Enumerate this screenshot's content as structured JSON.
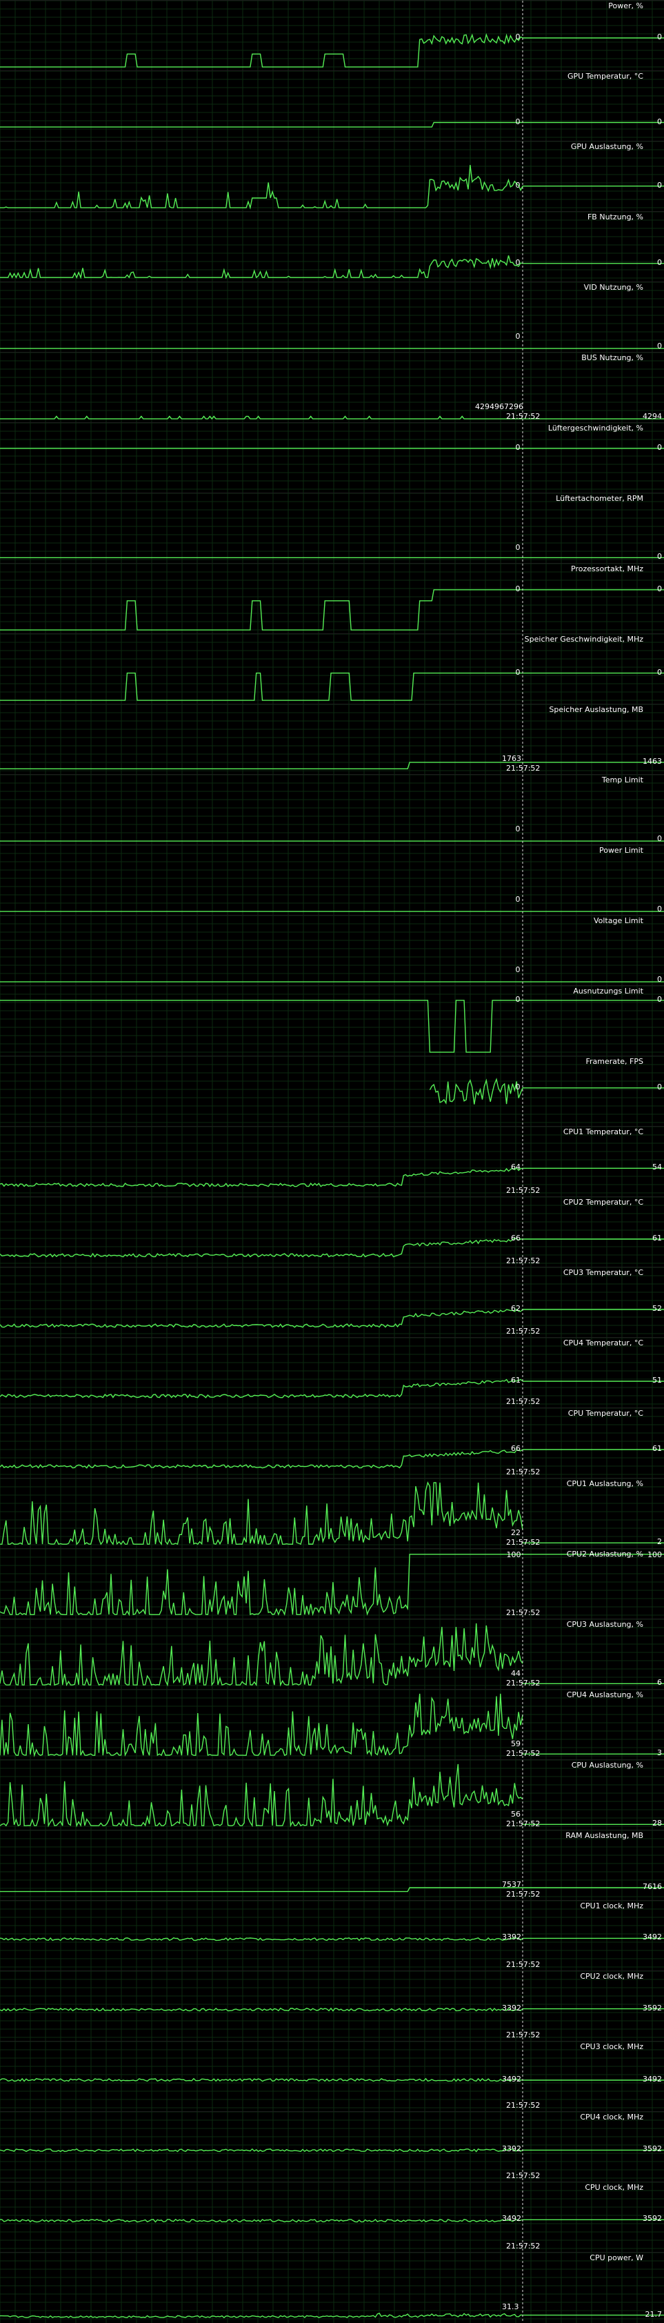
{
  "colors": {
    "grid": "#0b2a10",
    "line": "#55ee55",
    "cursor": "#dddddd",
    "background": "#000000"
  },
  "graphs": [
    {
      "title": "Power, %",
      "cursor": "0",
      "right": "0",
      "time": "",
      "pattern": "power"
    },
    {
      "title": "GPU Temperatur, °C",
      "cursor": "0",
      "right": "0",
      "time": "",
      "pattern": "flat_step"
    },
    {
      "title": "GPU Auslastung, %",
      "cursor": "0",
      "right": "0",
      "time": "",
      "pattern": "gpu_load"
    },
    {
      "title": "FB Nutzung, %",
      "cursor": "0",
      "right": "0",
      "time": "",
      "pattern": "fb"
    },
    {
      "title": "VID Nutzung, %",
      "cursor": "0",
      "right": "0",
      "time": "",
      "pattern": "zero"
    },
    {
      "title": "BUS Nutzung, %",
      "cursor": "4294967296",
      "right": "4294",
      "time": "21:57:52",
      "pattern": "bus"
    },
    {
      "title": "Lüftergeschwindigkeit, %",
      "cursor": "0",
      "right": "0",
      "time": "",
      "pattern": "fan"
    },
    {
      "title": "Lüftertachometer, RPM",
      "cursor": "0",
      "right": "0",
      "time": "",
      "pattern": "flat_low"
    },
    {
      "title": "Prozessortakt, MHz",
      "cursor": "0",
      "right": "0",
      "time": "",
      "pattern": "clock"
    },
    {
      "title": "Speicher Geschwindigkeit, MHz",
      "cursor": "0",
      "right": "0",
      "time": "",
      "pattern": "clock2"
    },
    {
      "title": "Speicher Auslastung, MB",
      "cursor": "1763",
      "right": "1463",
      "time": "21:57:52",
      "pattern": "mem"
    },
    {
      "title": "Temp Limit",
      "cursor": "0",
      "right": "0",
      "time": "",
      "pattern": "zero"
    },
    {
      "title": "Power Limit",
      "cursor": "0",
      "right": "0",
      "time": "",
      "pattern": "zero"
    },
    {
      "title": "Voltage Limit",
      "cursor": "0",
      "right": "0",
      "time": "",
      "pattern": "zero"
    },
    {
      "title": "Ausnutzungs Limit",
      "cursor": "0",
      "right": "0",
      "time": "",
      "pattern": "util_limit"
    },
    {
      "title": "Framerate, FPS",
      "cursor": "0",
      "right": "0",
      "time": "",
      "pattern": "fps"
    },
    {
      "title": "CPU1 Temperatur, °C",
      "cursor": "64",
      "right": "54",
      "time": "21:57:52",
      "pattern": "temp"
    },
    {
      "title": "CPU2 Temperatur, °C",
      "cursor": "66",
      "right": "61",
      "time": "21:57:52",
      "pattern": "temp"
    },
    {
      "title": "CPU3 Temperatur, °C",
      "cursor": "62",
      "right": "52",
      "time": "21:57:52",
      "pattern": "temp"
    },
    {
      "title": "CPU4 Temperatur, °C",
      "cursor": "61",
      "right": "51",
      "time": "21:57:52",
      "pattern": "temp"
    },
    {
      "title": "CPU Temperatur, °C",
      "cursor": "66",
      "right": "61",
      "time": "21:57:52",
      "pattern": "temp"
    },
    {
      "title": "CPU1 Auslastung, %",
      "cursor": "22",
      "right": "2",
      "time": "21:57:52",
      "pattern": "load"
    },
    {
      "title": "CPU2 Auslastung, %",
      "cursor": "100",
      "right": "100",
      "time": "21:57:52",
      "pattern": "load_full"
    },
    {
      "title": "CPU3 Auslastung, %",
      "cursor": "44",
      "right": "6",
      "time": "21:57:52",
      "pattern": "load"
    },
    {
      "title": "CPU4 Auslastung, %",
      "cursor": "59",
      "right": "3",
      "time": "21:57:52",
      "pattern": "load"
    },
    {
      "title": "CPU Auslastung, %",
      "cursor": "56",
      "right": "28",
      "time": "21:57:52",
      "pattern": "load"
    },
    {
      "title": "RAM Auslastung, MB",
      "cursor": "7537",
      "right": "7616",
      "time": "21:57:52",
      "pattern": "ram"
    },
    {
      "title": "CPU1 clock, MHz",
      "cursor": "3392",
      "right": "3492",
      "time": "21:57:52",
      "pattern": "cpuclock"
    },
    {
      "title": "CPU2 clock, MHz",
      "cursor": "3392",
      "right": "3592",
      "time": "21:57:52",
      "pattern": "cpuclock"
    },
    {
      "title": "CPU3 clock, MHz",
      "cursor": "3492",
      "right": "3492",
      "time": "21:57:52",
      "pattern": "cpuclock"
    },
    {
      "title": "CPU4 clock, MHz",
      "cursor": "3392",
      "right": "3592",
      "time": "21:57:52",
      "pattern": "cpuclock"
    },
    {
      "title": "CPU clock, MHz",
      "cursor": "3492",
      "right": "3592",
      "time": "21:57:52",
      "pattern": "cpuclock"
    },
    {
      "title": "CPU power, W",
      "cursor": "31.3",
      "right": "21.7",
      "time": "",
      "pattern": "cpupower"
    }
  ]
}
